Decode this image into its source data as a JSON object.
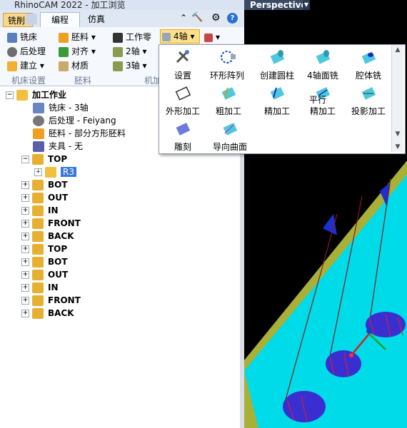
{
  "app": {
    "title": "RhinoCAM 2022 - 加工浏览"
  },
  "tabs": {
    "mill": "铣削",
    "edit": "编程",
    "sim": "仿真"
  },
  "ribbon": {
    "col1": [
      "铣床",
      "后处理",
      "建立"
    ],
    "col2": [
      "胚料",
      "对齐",
      "材质"
    ],
    "col3": [
      "工作零",
      "2轴",
      "3轴"
    ],
    "axis4": "4轴",
    "groups": [
      "机床设置",
      "胚料",
      "机加"
    ]
  },
  "tree": {
    "root": "加工作业",
    "children": [
      {
        "label": "铣床 - 3轴"
      },
      {
        "label": "后处理 - Feiyang"
      },
      {
        "label": "胚料 - 部分方形胚料"
      },
      {
        "label": "夹具 - 无"
      }
    ],
    "setups": [
      "TOP",
      "BOT",
      "OUT",
      "IN",
      "FRONT",
      "BACK",
      "TOP",
      "BOT",
      "OUT",
      "IN",
      "FRONT",
      "BACK"
    ],
    "selected_child": "R3"
  },
  "viewport": {
    "label": "Perspective"
  },
  "popup": {
    "row1": [
      "设置",
      "环形阵列",
      "创建圆柱",
      "4轴面铣",
      "腔体铣"
    ],
    "row2": [
      "外形加工",
      "粗加工",
      "精加工",
      "精加工",
      "投影加工"
    ],
    "row2_overlay": "平行",
    "row3": [
      "雕刻",
      "导向曲面"
    ]
  },
  "colors": {
    "accent": "#1e6fd9",
    "cyan": "#00d8e8",
    "selected": "#3a78d8"
  }
}
